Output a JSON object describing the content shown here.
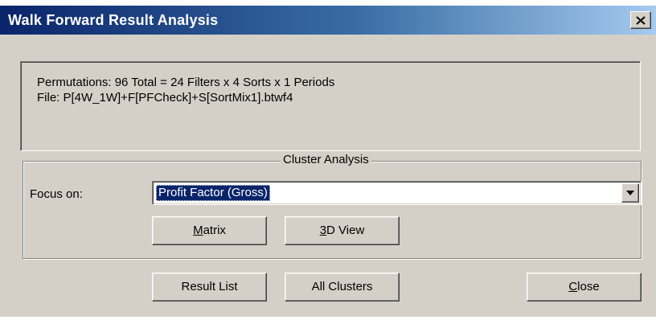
{
  "window": {
    "title": "Walk Forward Result Analysis",
    "close_glyph": "close-icon"
  },
  "info": {
    "permutations": "Permutations: 96 Total = 24 Filters x 4 Sorts x 1 Periods",
    "file": "File: P[4W_1W]+F[PFCheck]+S[SortMix1].btwf4"
  },
  "cluster": {
    "group_title": "Cluster Analysis",
    "focus_label": "Focus on:",
    "focus_value": "Profit Factor (Gross)",
    "matrix_button": {
      "hotkey": "M",
      "rest": "atrix"
    },
    "view3d_button": {
      "hotkey": "3",
      "rest": "D View"
    }
  },
  "footer": {
    "result_list_button": "Result List",
    "all_clusters_button": "All Clusters",
    "close_button": {
      "hotkey": "C",
      "rest": "lose"
    }
  },
  "colors": {
    "titlebar_start": "#0a246a",
    "titlebar_end": "#a6caf0",
    "dialog_face": "#d4d0c8",
    "selection": "#0a246a"
  }
}
